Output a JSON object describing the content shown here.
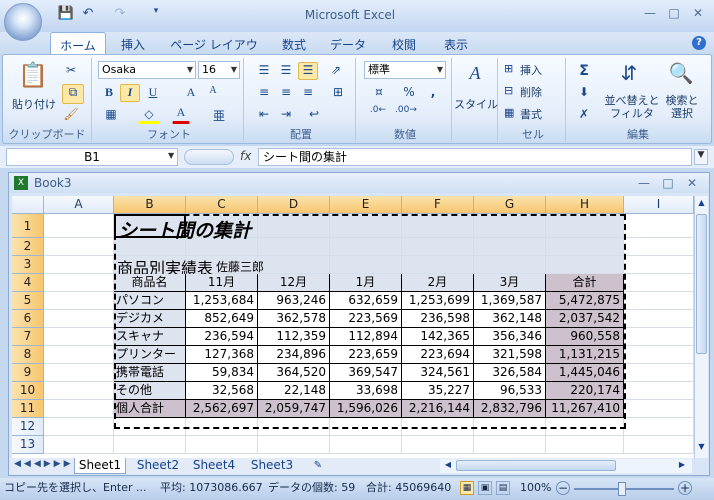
{
  "app": {
    "title": "Microsoft Excel",
    "quick_access": [
      "save-icon",
      "undo-icon",
      "redo-icon",
      "customize-icon"
    ]
  },
  "tabs": [
    "ホーム",
    "挿入",
    "ページ レイアウト",
    "数式",
    "データ",
    "校閲",
    "表示"
  ],
  "ribbon": {
    "clipboard": {
      "paste": "貼り付け",
      "label": "クリップボード"
    },
    "font": {
      "name": "Osaka",
      "size": "16",
      "bold": "B",
      "italic": "I",
      "underline": "U",
      "grow": "A",
      "shrink": "A",
      "fontcolor": "A",
      "kana": "亜",
      "label": "フォント"
    },
    "alignment": {
      "label": "配置"
    },
    "number": {
      "format": "標準",
      "percent": "%",
      "comma": ",",
      "label": "数値"
    },
    "styles": {
      "label": "スタイル"
    },
    "cells": {
      "insert": "挿入",
      "delete": "削除",
      "format": "書式",
      "label": "セル"
    },
    "editing": {
      "sigma": "Σ",
      "sort": "並べ替えと\nフィルタ",
      "find": "検索と\n選択",
      "label": "編集"
    }
  },
  "formula_bar": {
    "name_box": "B1",
    "fx": "fx",
    "formula": "シート間の集計"
  },
  "workbook": {
    "title": "Book3"
  },
  "sheet": {
    "columns": [
      "A",
      "B",
      "C",
      "D",
      "E",
      "F",
      "G",
      "H",
      "I"
    ],
    "title": "シート間の集計",
    "subtitle": "商品別実績表",
    "author": "佐藤三郎",
    "headers": [
      "商品名",
      "11月",
      "12月",
      "1月",
      "2月",
      "3月",
      "合計"
    ],
    "rows": [
      [
        "パソコン",
        "1,253,684",
        "963,246",
        "632,659",
        "1,253,699",
        "1,369,587",
        "5,472,875"
      ],
      [
        "デジカメ",
        "852,649",
        "362,578",
        "223,569",
        "236,598",
        "362,148",
        "2,037,542"
      ],
      [
        "スキャナ",
        "236,594",
        "112,359",
        "112,894",
        "142,365",
        "356,346",
        "960,558"
      ],
      [
        "プリンター",
        "127,368",
        "234,896",
        "223,659",
        "223,694",
        "321,598",
        "1,131,215"
      ],
      [
        "携帯電話",
        "59,834",
        "364,520",
        "369,547",
        "324,561",
        "326,584",
        "1,445,046"
      ],
      [
        "その他",
        "32,568",
        "22,148",
        "33,698",
        "35,227",
        "96,533",
        "220,174"
      ],
      [
        "個人合計",
        "2,562,697",
        "2,059,747",
        "1,596,026",
        "2,216,144",
        "2,832,796",
        "11,267,410"
      ]
    ],
    "row_numbers": [
      "1",
      "2",
      "3",
      "4",
      "5",
      "6",
      "7",
      "8",
      "9",
      "10",
      "11",
      "12",
      "13"
    ]
  },
  "sheet_tabs": [
    "Sheet1",
    "Sheet2",
    "Sheet4",
    "Sheet3"
  ],
  "status": {
    "message": "コピー先を選択し、Enter ...",
    "average": "平均: 1073086.667",
    "count": "データの個数: 59",
    "sum": "合計: 45069640",
    "zoom": "100%"
  }
}
